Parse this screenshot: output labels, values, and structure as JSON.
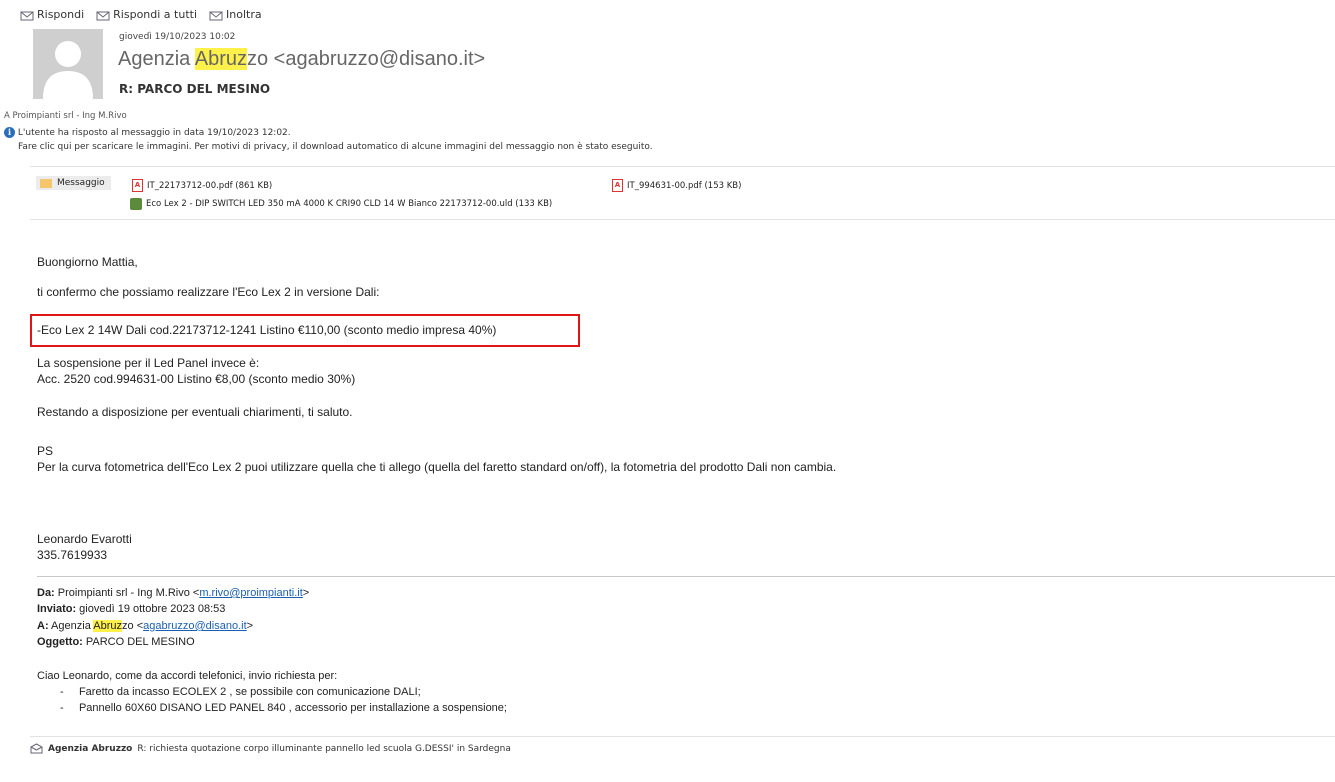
{
  "toolbar": {
    "reply": "Rispondi",
    "reply_all": "Rispondi a tutti",
    "forward": "Inoltra"
  },
  "header": {
    "date": "giovedì 19/10/2023 10:02",
    "sender_name_prefix": "Agenzia ",
    "sender_name_highlight": "Abruz",
    "sender_name_suffix": "zo <agabruzzo@disano.it>",
    "subject": "R: PARCO DEL MESINO",
    "to": "A   Proimpianti srl - Ing M.Rivo",
    "info_line1": "L'utente ha risposto al messaggio in data 19/10/2023 12:02.",
    "info_line2": "Fare clic qui per scaricare le immagini. Per motivi di privacy, il download automatico di alcune immagini del messaggio non è stato eseguito."
  },
  "attachments": {
    "message_tab": "Messaggio",
    "files": [
      "IT_22173712-00.pdf (861 KB)",
      "IT_994631-00.pdf (153 KB)",
      "Eco Lex 2 - DIP SWITCH LED 350 mA 4000 K CRI90 CLD 14 W Bianco 22173712-00.uld (133 KB)"
    ]
  },
  "body": {
    "greeting": "Buongiorno Mattia,",
    "line1": "ti confermo che possiamo realizzare l'Eco Lex 2 in versione Dali:",
    "highlighted": "-Eco Lex 2 14W Dali cod.22173712-1241 Listino €110,00 (sconto medio impresa 40%)",
    "line2": "La sospensione per il Led Panel invece è:",
    "line3": "Acc. 2520 cod.994631-00 Listino €8,00 (sconto medio 30%)",
    "line4": "Restando a disposizione per eventuali chiarimenti, ti saluto.",
    "ps": "PS",
    "line5": "Per la curva fotometrica dell'Eco Lex 2 puoi utilizzare quella che ti allego (quella del faretto standard on/off), la fotometria del prodotto Dali non cambia.",
    "sig_name": "Leonardo Evarotti",
    "sig_phone": "335.7619933"
  },
  "quoted": {
    "from_label": "Da:",
    "from_value": " Proimpianti srl - Ing M.Rivo <",
    "from_email": "m.rivo@proimpianti.it",
    "from_close": ">",
    "sent_label": "Inviato:",
    "sent_value": " giovedì 19 ottobre 2023 08:53",
    "to_label": "A:",
    "to_value_prefix": " Agenzia ",
    "to_value_highlight": "Abruz",
    "to_value_suffix": "zo <",
    "to_email": "agabruzzo@disano.it",
    "to_close": ">",
    "subject_label": "Oggetto:",
    "subject_value": " PARCO DEL MESINO",
    "intro": "Ciao Leonardo, come da accordi telefonici, invio richiesta per:",
    "bullets": [
      "Faretto da incasso ECOLEX 2 , se   possibile con comunicazione DALI;",
      "Pannello 60X60 DISANO LED PANEL 840 , accessorio per installazione a sospensione;"
    ]
  },
  "footer": {
    "sender": "Agenzia Abruzzo",
    "subject": "R: richiesta quotazione corpo illuminante pannello led scuola G.DESSI'  in Sardegna"
  }
}
